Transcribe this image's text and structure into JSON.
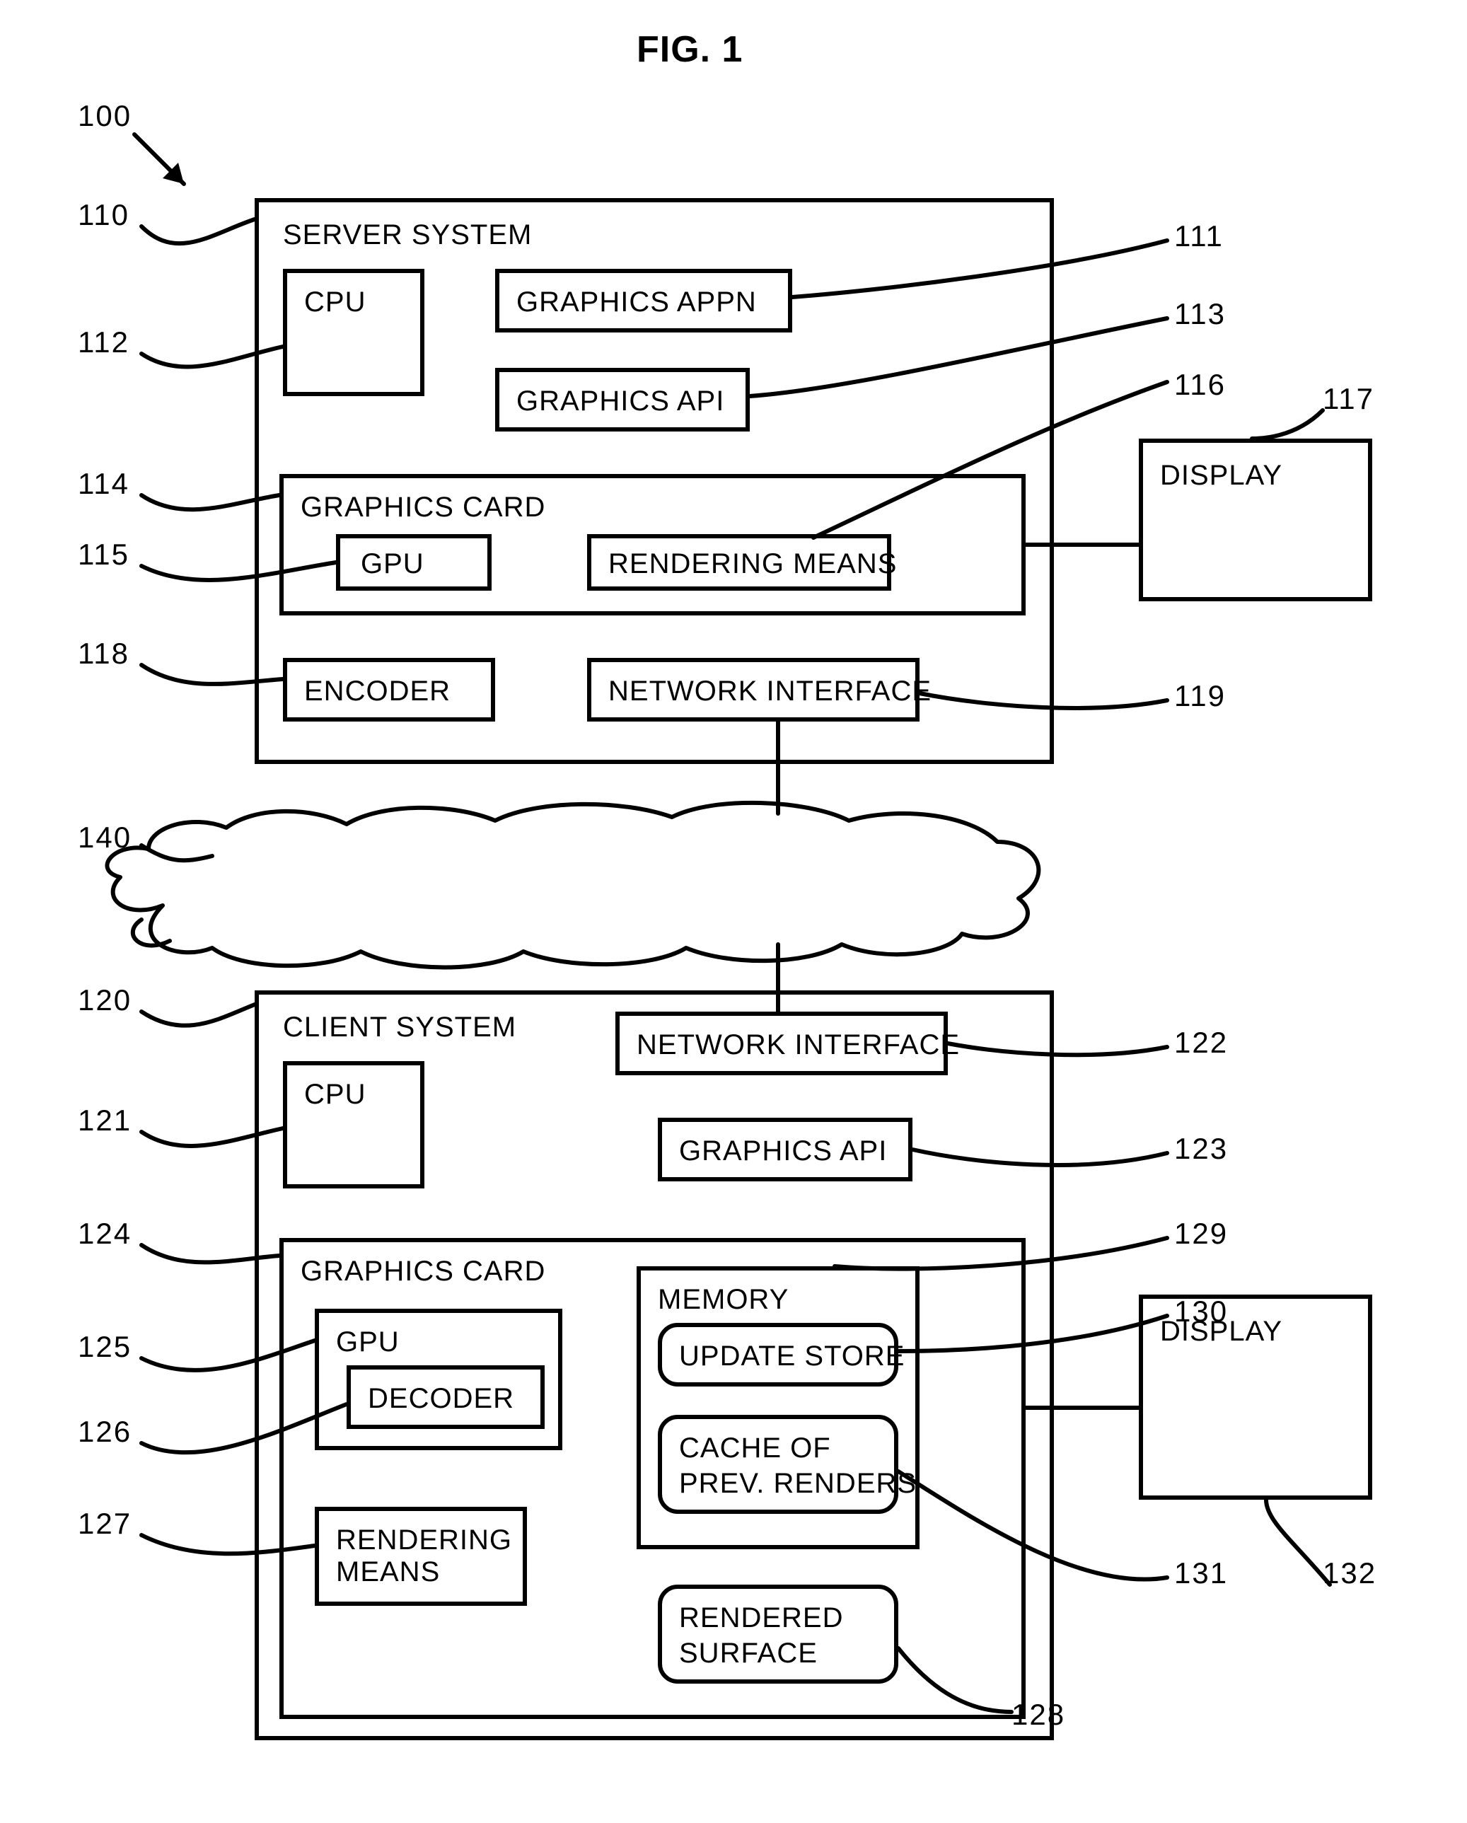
{
  "title": "FIG. 1",
  "refs": {
    "r100": "100",
    "r110": "110",
    "r111": "111",
    "r112": "112",
    "r113": "113",
    "r114": "114",
    "r115": "115",
    "r116": "116",
    "r117": "117",
    "r118": "118",
    "r119": "119",
    "r140": "140",
    "r120": "120",
    "r121": "121",
    "r122": "122",
    "r123": "123",
    "r124": "124",
    "r125": "125",
    "r126": "126",
    "r127": "127",
    "r128": "128",
    "r129": "129",
    "r130": "130",
    "r131": "131",
    "r132": "132"
  },
  "server": {
    "title": "SERVER SYSTEM",
    "cpu": "CPU",
    "appn": "GRAPHICS APPN",
    "api": "GRAPHICS API",
    "card": "GRAPHICS CARD",
    "gpu": "GPU",
    "render": "RENDERING MEANS",
    "encoder": "ENCODER",
    "netif": "NETWORK INTERFACE",
    "display": "DISPLAY"
  },
  "client": {
    "title": "CLIENT SYSTEM",
    "cpu": "CPU",
    "netif": "NETWORK INTERFACE",
    "api": "GRAPHICS API",
    "card": "GRAPHICS CARD",
    "gpu": "GPU",
    "decoder": "DECODER",
    "render_l1": "RENDERING",
    "render_l2": "MEANS",
    "memory": "MEMORY",
    "update": "UPDATE STORE",
    "cache_l1": "CACHE OF",
    "cache_l2": "PREV. RENDERS",
    "surface_l1": "RENDERED",
    "surface_l2": "SURFACE",
    "display": "DISPLAY"
  }
}
